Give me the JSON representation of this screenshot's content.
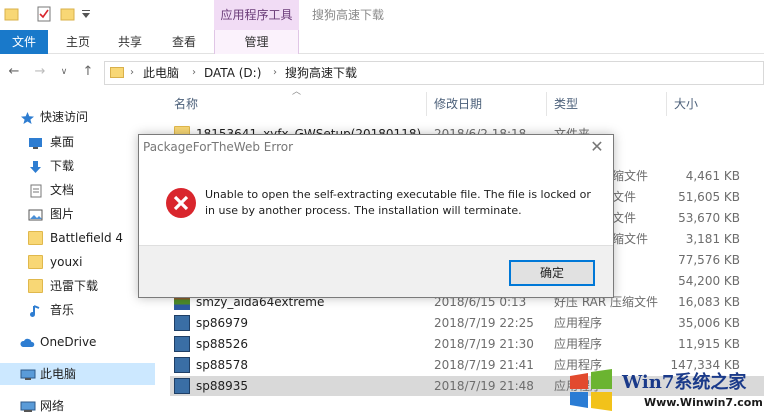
{
  "window": {
    "title": "搜狗高速下载",
    "context_tab_header": "应用程序工具"
  },
  "ribbon": {
    "tabs": [
      "文件",
      "主页",
      "共享",
      "查看",
      "管理"
    ]
  },
  "address": {
    "crumbs": [
      "此电脑",
      "DATA (D:)",
      "搜狗高速下载"
    ]
  },
  "sidebar": {
    "items": [
      {
        "label": "快速访问",
        "icon": "star-icon"
      },
      {
        "label": "桌面",
        "icon": "desktop-icon"
      },
      {
        "label": "下载",
        "icon": "download-icon"
      },
      {
        "label": "文档",
        "icon": "document-icon"
      },
      {
        "label": "图片",
        "icon": "picture-icon"
      },
      {
        "label": "Battlefield 4",
        "icon": "folder-icon"
      },
      {
        "label": "youxi",
        "icon": "folder-icon"
      },
      {
        "label": "迅雷下载",
        "icon": "folder-icon"
      },
      {
        "label": "音乐",
        "icon": "music-icon"
      },
      {
        "label": "OneDrive",
        "icon": "cloud-icon"
      },
      {
        "label": "此电脑",
        "icon": "computer-icon"
      },
      {
        "label": "网络",
        "icon": "network-icon"
      }
    ]
  },
  "columns": {
    "name": "名称",
    "date": "修改日期",
    "type": "类型",
    "size": "大小"
  },
  "files": [
    {
      "name": "18153641_xyfx_GWSetup(20180118)",
      "date": "2018/6/2 18:18",
      "type": "文件夹",
      "size": ""
    },
    {
      "name": "",
      "date": "",
      "type": "压缩文件",
      "size": "4,461 KB"
    },
    {
      "name": "",
      "date": "",
      "type": "缩文件",
      "size": "51,605 KB"
    },
    {
      "name": "",
      "date": "",
      "type": "缩文件",
      "size": "53,670 KB"
    },
    {
      "name": "",
      "date": "",
      "type": "压缩文件",
      "size": "3,181 KB"
    },
    {
      "name": "",
      "date": "",
      "type": "",
      "size": "77,576 KB"
    },
    {
      "name": "",
      "date": "",
      "type": "",
      "size": "54,200 KB"
    },
    {
      "name": "smzy_aida64extreme",
      "date": "2018/6/15 0:13",
      "type": "好压 RAR 压缩文件",
      "size": "16,083 KB"
    },
    {
      "name": "sp86979",
      "date": "2018/7/19 22:25",
      "type": "应用程序",
      "size": "35,006 KB"
    },
    {
      "name": "sp88526",
      "date": "2018/7/19 21:30",
      "type": "应用程序",
      "size": "11,915 KB"
    },
    {
      "name": "sp88578",
      "date": "2018/7/19 21:41",
      "type": "应用程序",
      "size": "147,334 KB"
    },
    {
      "name": "sp88935",
      "date": "2018/7/19 21:48",
      "type": "应用程序",
      "size": ""
    }
  ],
  "dialog": {
    "title": "PackageForTheWeb Error",
    "message": "Unable to open the self-extracting executable file.  The file is locked or\nin use by another process.  The installation will terminate.",
    "ok_label": "确定"
  },
  "watermark": {
    "brand": "Win7系统之家",
    "url": "Www.Winwin7.com"
  }
}
